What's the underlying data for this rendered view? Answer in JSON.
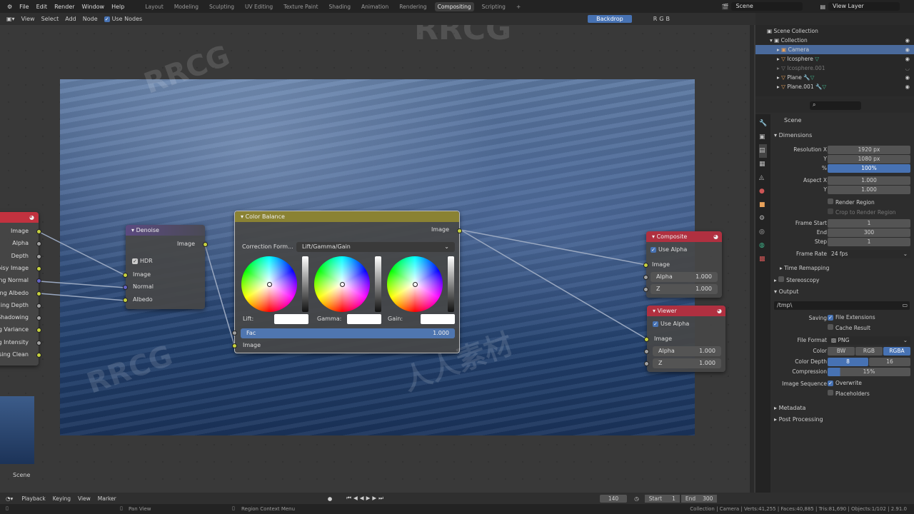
{
  "menu": [
    "File",
    "Edit",
    "Render",
    "Window",
    "Help"
  ],
  "workspaces": [
    "Layout",
    "Modeling",
    "Sculpting",
    "UV Editing",
    "Texture Paint",
    "Shading",
    "Animation",
    "Rendering",
    "Compositing",
    "Scripting"
  ],
  "active_workspace": "Compositing",
  "scene": "Scene",
  "view_layer": "View Layer",
  "editor_header": {
    "menus": [
      "View",
      "Select",
      "Add",
      "Node"
    ],
    "use_nodes": "Use Nodes",
    "backdrop": "Backdrop",
    "channels": [
      "R",
      "G",
      "B"
    ]
  },
  "render_layers_node": {
    "outputs": [
      "Image",
      "Alpha",
      "Depth",
      "oisy Image",
      "ing Normal",
      "ing Albedo",
      "ing Depth",
      "Shadowing",
      "g Variance",
      "g Intensity",
      "sing Clean"
    ],
    "thumb_label": "Scene"
  },
  "denoise_node": {
    "title": "Denoise",
    "output": "Image",
    "hdr": "HDR",
    "inputs": [
      "Image",
      "Normal",
      "Albedo"
    ]
  },
  "color_balance_node": {
    "title": "Color Balance",
    "output": "Image",
    "correction_label": "Correction Form...",
    "correction_value": "Lift/Gamma/Gain",
    "lift": "Lift:",
    "gamma": "Gamma:",
    "gain": "Gain:",
    "fac_label": "Fac",
    "fac_value": "1.000",
    "input": "Image"
  },
  "composite_node": {
    "title": "Composite",
    "use_alpha": "Use Alpha",
    "image": "Image",
    "alpha_label": "Alpha",
    "alpha": "1.000",
    "z_label": "Z",
    "z": "1.000"
  },
  "viewer_node": {
    "title": "Viewer",
    "use_alpha": "Use Alpha",
    "image": "Image",
    "alpha_label": "Alpha",
    "alpha": "1.000",
    "z_label": "Z",
    "z": "1.000"
  },
  "outliner": {
    "root": "Scene Collection",
    "collection": "Collection",
    "items": [
      "Camera",
      "Icosphere",
      "Icosphere.001",
      "Plane",
      "Plane.001"
    ]
  },
  "properties": {
    "context": "Scene",
    "dimensions": {
      "title": "Dimensions",
      "res_x_label": "Resolution X",
      "res_x": "1920 px",
      "res_y_label": "Y",
      "res_y": "1080 px",
      "pct_label": "%",
      "pct": "100%",
      "aspect_x_label": "Aspect X",
      "aspect_x": "1.000",
      "aspect_y_label": "Y",
      "aspect_y": "1.000",
      "render_region": "Render Region",
      "crop": "Crop to Render Region",
      "frame_start_label": "Frame Start",
      "frame_start": "1",
      "end_label": "End",
      "end": "300",
      "step_label": "Step",
      "step": "1",
      "frame_rate_label": "Frame Rate",
      "frame_rate": "24 fps",
      "time_remapping": "Time Remapping"
    },
    "stereoscopy": "Stereoscopy",
    "output": {
      "title": "Output",
      "path": "/tmp\\",
      "saving_label": "Saving",
      "file_extensions": "File Extensions",
      "cache_result": "Cache Result",
      "file_format_label": "File Format",
      "file_format": "PNG",
      "color_label": "Color",
      "color_options": [
        "BW",
        "RGB",
        "RGBA"
      ],
      "color_selected": "RGBA",
      "depth_label": "Color Depth",
      "depth_options": [
        "8",
        "16"
      ],
      "compression_label": "Compression",
      "compression": "15%",
      "compression_fraction": 0.15,
      "image_sequence_label": "Image Sequence",
      "overwrite": "Overwrite",
      "placeholders": "Placeholders"
    },
    "metadata": "Metadata",
    "post_processing": "Post Processing"
  },
  "timeline": {
    "menus": [
      "Playback",
      "Keying",
      "View",
      "Marker"
    ],
    "current_frame": "140",
    "start_label": "Start",
    "start": "1",
    "end_label": "End",
    "end": "300"
  },
  "status": {
    "left": "Pan View",
    "middle": "Region Context Menu",
    "stats": "Collection | Camera | Verts:41,255 | Faces:40,885 | Tris:81,690 | Objects:1/102 | 2.91.0"
  },
  "watermark": [
    "RRCG",
    "人人素材"
  ]
}
